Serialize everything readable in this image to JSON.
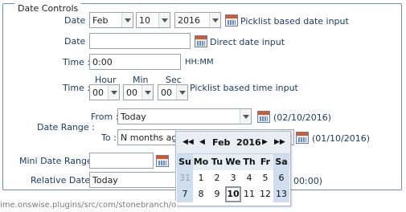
{
  "legend": "Date Controls",
  "row1": {
    "label": "Date :",
    "month": "Feb",
    "day": "10",
    "year": "2016",
    "note": "Picklist based date input"
  },
  "row2": {
    "label": "Date :",
    "value": "",
    "note": "Direct date input"
  },
  "row3": {
    "label": "Time :",
    "value": "0:00",
    "hint": "HH:MM"
  },
  "row4": {
    "label": "Time :",
    "hour_label": "Hour",
    "min_label": "Min",
    "sec_label": "Sec",
    "hour": "00",
    "min": "00",
    "sec": "00",
    "note": "Picklist based time input"
  },
  "range": {
    "label": "Date Range :",
    "from_label": "From :",
    "from_value": "Today",
    "from_result": "(02/10/2016)",
    "to_label": "To :",
    "to_value": "N months ago",
    "to_result": "(01/10/2016)"
  },
  "mini": {
    "label": "Mini Date Range :"
  },
  "relative": {
    "label": "Relative Date :",
    "value": "Today",
    "suffix": "00:00)"
  },
  "calendar": {
    "prev_year": "◀◀",
    "prev_month": "◀",
    "title": "Feb  2016",
    "next_month": "▶",
    "next_year": "▶▶",
    "day_names": [
      "Su",
      "Mo",
      "Tu",
      "We",
      "Th",
      "Fr",
      "Sa"
    ],
    "week1": [
      "31",
      "1",
      "2",
      "3",
      "4",
      "5",
      "6"
    ],
    "week2": [
      "7",
      "8",
      "9",
      "10",
      "11",
      "12",
      "13"
    ]
  },
  "status_url": "ime.onswise.plugins/src/com/stonebranch/opswise/client/Panel/TriggerPanel.java"
}
